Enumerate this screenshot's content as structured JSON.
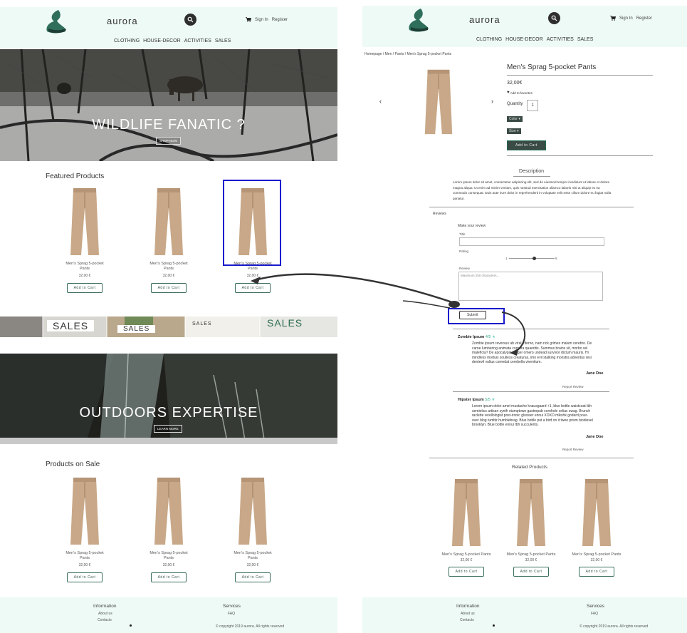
{
  "header": {
    "brand": "aurora",
    "sign_in": "Sign In",
    "register": "Register",
    "nav": [
      "CLOTHING",
      "HOUSE-DECOR",
      "ACTIVITIES",
      "SALES"
    ]
  },
  "home": {
    "hero_title": "WILDLIFE FANATIC ?",
    "hero_button": "SHOP NOW",
    "featured_title": "Featured Products",
    "sales_words": [
      "SALES",
      "SALES",
      "SALES",
      "SALES"
    ],
    "outdoors_title": "OUTDOORS EXPERTISE",
    "outdoors_button": "LEARN MORE",
    "sale_title": "Products on Sale",
    "product_name_1": "Men's Sprag 5-pocket",
    "product_name_2": "Pants",
    "product_price": "32,00 €",
    "add_to_cart": "Add to Cart"
  },
  "footer": {
    "info_title": "Information",
    "about": "About us",
    "contacts": "Contacts",
    "services_title": "Services",
    "faq": "FAQ",
    "copyright": "© copyright 2019 aurora. All rights reserved"
  },
  "product": {
    "breadcrumb": "Homepage  /  Men  /  Pants  /  Men's Sprag 5-pocket Pants",
    "name": "Men's Sprag 5-pocket Pants",
    "price": "32,00€",
    "favorites": "Add to favorites",
    "quantity_label": "Quantity",
    "quantity_value": "1",
    "color_label": "Color",
    "size_label": "Size",
    "add_to_cart": "Add to Cart",
    "description_title": "Description",
    "description": "Lorem ipsum dolor sit amet, consectetur adipiscing elit, sed do eiusmod tempor incididunt ut labore et dolore magna aliqua. Ut enim ad minim veniam, quis nostrud exercitation ullamco laboris nisi ut aliquip ex ea commodo consequat. Duis aute irure dolor in reprehenderit in voluptate velit esse cillum dolore eu fugiat nulla pariatur.",
    "reviews_title": "Reviews",
    "make_review": "Make your review",
    "title_label": "Title",
    "rating_label": "Rating",
    "rating_min": "1",
    "rating_max": "5",
    "rating_value": 0.55,
    "review_label": "Review",
    "review_placeholder": "Maximum 250 characters...",
    "submit": "Submit",
    "reviews": [
      {
        "title": "Zombie Ipsum",
        "score": "4/5",
        "text": "Zombie ipsum reversus ab viral inferno, nam rick grimes malum cerebro. De carne lumbering animata corpora quaeritis. Summus brains sit, morbo vel maleficia? De apocalypsi gorger omero undead survivor dictum mauris. Hi mindless mortuis soulless creaturas, imo evil stalking monstra adventus resi dentevil vultus comedat cerebella viventium.",
        "author": "Jane Doe",
        "report": "Report Review"
      },
      {
        "title": "Hipster Ipsum",
        "score": "5/5",
        "text": "Lorem ipsum dolor amet mustache knausgaard +1, blue bottle waistcoat tbh semiotics artisan synth stumptown gastropub cornhole celiac swag. Brunch raclette vexillologist post-ironic glossier ennui XOXO mlkshk godard pour-over blog tumblr humblebrag. Blue bottle put a bird on it twee prism biodiesel brooklyn. Blue bottle ennui tbh succulents.",
        "author": "Jane Doe",
        "report": "Report Review"
      }
    ],
    "related_title": "Related Products",
    "related_name": "Men's Sprag 5-pocket Pants",
    "related_price": "32,00 €"
  }
}
